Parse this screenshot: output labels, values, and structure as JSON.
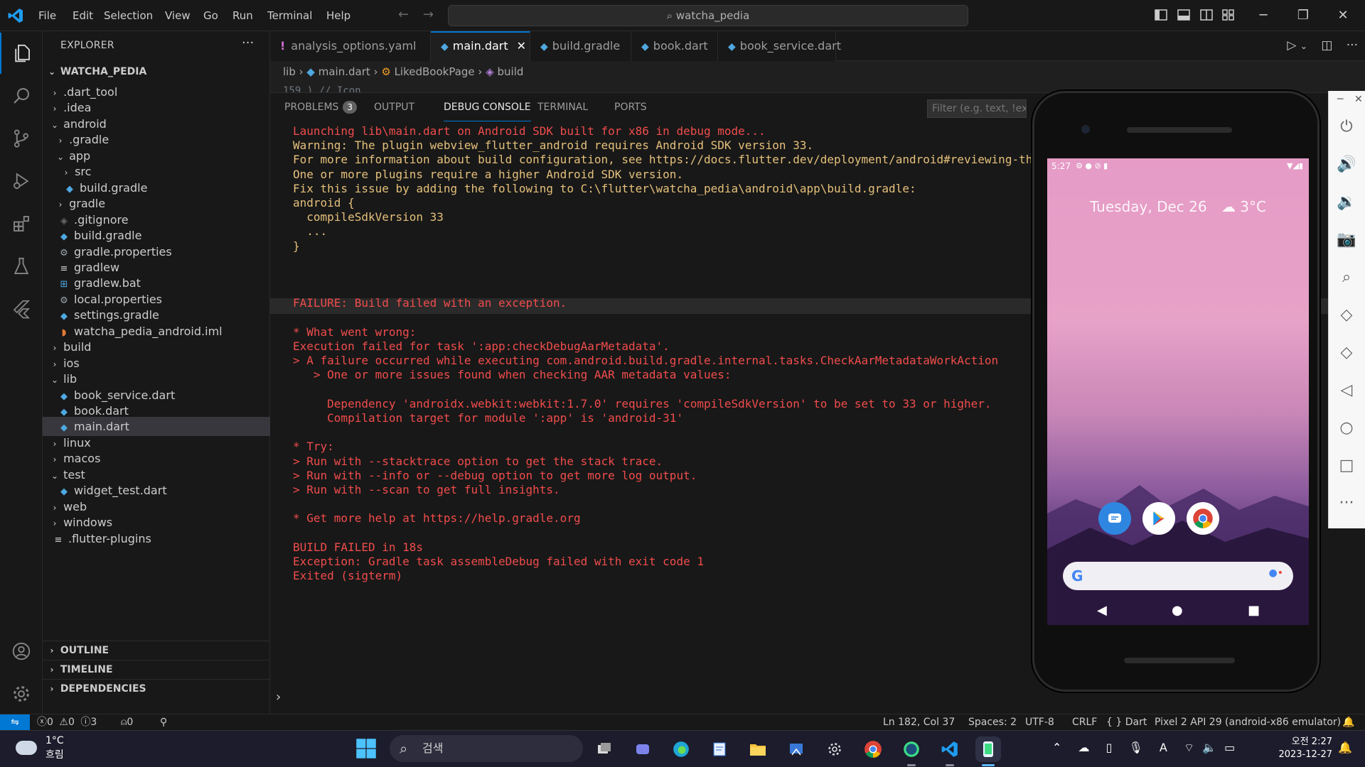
{
  "titlebar": {
    "menus": [
      "File",
      "Edit",
      "Selection",
      "View",
      "Go",
      "Run",
      "Terminal",
      "Help"
    ],
    "search": "watcha_pedia"
  },
  "explorer": {
    "title": "EXPLORER",
    "root": "WATCHA_PEDIA",
    "items": [
      {
        "label": ".dart_tool",
        "type": "folder",
        "open": false,
        "depth": 1
      },
      {
        "label": ".idea",
        "type": "folder",
        "open": false,
        "depth": 1
      },
      {
        "label": "android",
        "type": "folder",
        "open": true,
        "depth": 1
      },
      {
        "label": ".gradle",
        "type": "folder",
        "open": false,
        "depth": 2
      },
      {
        "label": "app",
        "type": "folder",
        "open": true,
        "depth": 2
      },
      {
        "label": "src",
        "type": "folder",
        "open": false,
        "depth": 3
      },
      {
        "label": "build.gradle",
        "type": "gradle",
        "depth": 3
      },
      {
        "label": "gradle",
        "type": "folder",
        "open": false,
        "depth": 2
      },
      {
        "label": ".gitignore",
        "type": "git",
        "depth": 2
      },
      {
        "label": "build.gradle",
        "type": "gradle",
        "depth": 2
      },
      {
        "label": "gradle.properties",
        "type": "gear",
        "depth": 2
      },
      {
        "label": "gradlew",
        "type": "lines",
        "depth": 2
      },
      {
        "label": "gradlew.bat",
        "type": "windows",
        "depth": 2
      },
      {
        "label": "local.properties",
        "type": "gear",
        "depth": 2
      },
      {
        "label": "settings.gradle",
        "type": "gradle",
        "depth": 2
      },
      {
        "label": "watcha_pedia_android.iml",
        "type": "rss",
        "depth": 2
      },
      {
        "label": "build",
        "type": "folder",
        "open": false,
        "depth": 1
      },
      {
        "label": "ios",
        "type": "folder",
        "open": false,
        "depth": 1
      },
      {
        "label": "lib",
        "type": "folder",
        "open": true,
        "depth": 1
      },
      {
        "label": "book_service.dart",
        "type": "dart",
        "depth": 2
      },
      {
        "label": "book.dart",
        "type": "dart",
        "depth": 2
      },
      {
        "label": "main.dart",
        "type": "dart",
        "depth": 2,
        "selected": true
      },
      {
        "label": "linux",
        "type": "folder",
        "open": false,
        "depth": 1
      },
      {
        "label": "macos",
        "type": "folder",
        "open": false,
        "depth": 1
      },
      {
        "label": "test",
        "type": "folder",
        "open": true,
        "depth": 1
      },
      {
        "label": "widget_test.dart",
        "type": "dart",
        "depth": 2
      },
      {
        "label": "web",
        "type": "folder",
        "open": false,
        "depth": 1
      },
      {
        "label": "windows",
        "type": "folder",
        "open": false,
        "depth": 1
      },
      {
        "label": ".flutter-plugins",
        "type": "lines",
        "depth": 1
      }
    ],
    "sections": [
      "OUTLINE",
      "TIMELINE",
      "DEPENDENCIES"
    ]
  },
  "tabs": [
    {
      "label": "analysis_options.yaml",
      "icon": "!"
    },
    {
      "label": "main.dart",
      "active": true
    },
    {
      "label": "build.gradle"
    },
    {
      "label": "book.dart"
    },
    {
      "label": "book_service.dart"
    }
  ],
  "breadcrumb": {
    "p1": "lib",
    "p2": "main.dart",
    "p3": "LikedBookPage",
    "p4": "build"
  },
  "code_peek": "159                    )  // Icon",
  "panel": {
    "tabs": [
      "PROBLEMS",
      "OUTPUT",
      "DEBUG CONSOLE",
      "TERMINAL",
      "PORTS"
    ],
    "problems_count": "3",
    "filter_placeholder": "Filter (e.g. text, !exclude)",
    "console": {
      "l1": "Launching lib\\main.dart on Android SDK built for x86 in debug mode...",
      "l2": "Warning: The plugin webview_flutter_android requires Android SDK version 33.",
      "l3": "For more information about build configuration, see https://docs.flutter.dev/deployment/android#reviewing-the-gradle-build-configuration.",
      "l4": "One or more plugins require a higher Android SDK version.",
      "l5": "Fix this issue by adding the following to C:\\flutter\\watcha_pedia\\android\\app\\build.gradle:",
      "l6": "android {",
      "l7": "  compileSdkVersion 33",
      "l8": "  ...",
      "l9": "}",
      "l10": "FAILURE: Build failed with an exception.",
      "l11": "* What went wrong:",
      "l12": "Execution failed for task ':app:checkDebugAarMetadata'.",
      "l13": "> A failure occurred while executing com.android.build.gradle.internal.tasks.CheckAarMetadataWorkAction",
      "l14": "   > One or more issues found when checking AAR metadata values:",
      "l15": "     Dependency 'androidx.webkit:webkit:1.7.0' requires 'compileSdkVersion' to be set to 33 or higher.",
      "l16": "     Compilation target for module ':app' is 'android-31'",
      "l17": "* Try:",
      "l18": "> Run with --stacktrace option to get the stack trace.",
      "l19": "> Run with --info or --debug option to get more log output.",
      "l20": "> Run with --scan to get full insights.",
      "l21": "* Get more help at https://help.gradle.org",
      "l22": "BUILD FAILED in 18s",
      "l23": "Exception: Gradle task assembleDebug failed with exit code 1",
      "l24": "Exited (sigterm)"
    }
  },
  "statusbar": {
    "errors": "0",
    "warnings": "0",
    "info": "3",
    "ports": "0",
    "position": "Ln 182, Col 37",
    "spaces": "Spaces: 2",
    "encoding": "UTF-8",
    "eol": "CRLF",
    "language": "Dart",
    "device": "Pixel 2 API 29 (android-x86 emulator)"
  },
  "emulator": {
    "time": "5:27",
    "date": "Tuesday, Dec 26",
    "temp": "3°C"
  },
  "taskbar": {
    "weather_temp": "1°C",
    "weather_desc": "흐림",
    "search": "검색",
    "clock_time": "오전 2:27",
    "clock_date": "2023-12-27"
  },
  "colors": {
    "accent": "#0078d4",
    "error": "#f14c4c",
    "warning": "#e5c07b"
  }
}
